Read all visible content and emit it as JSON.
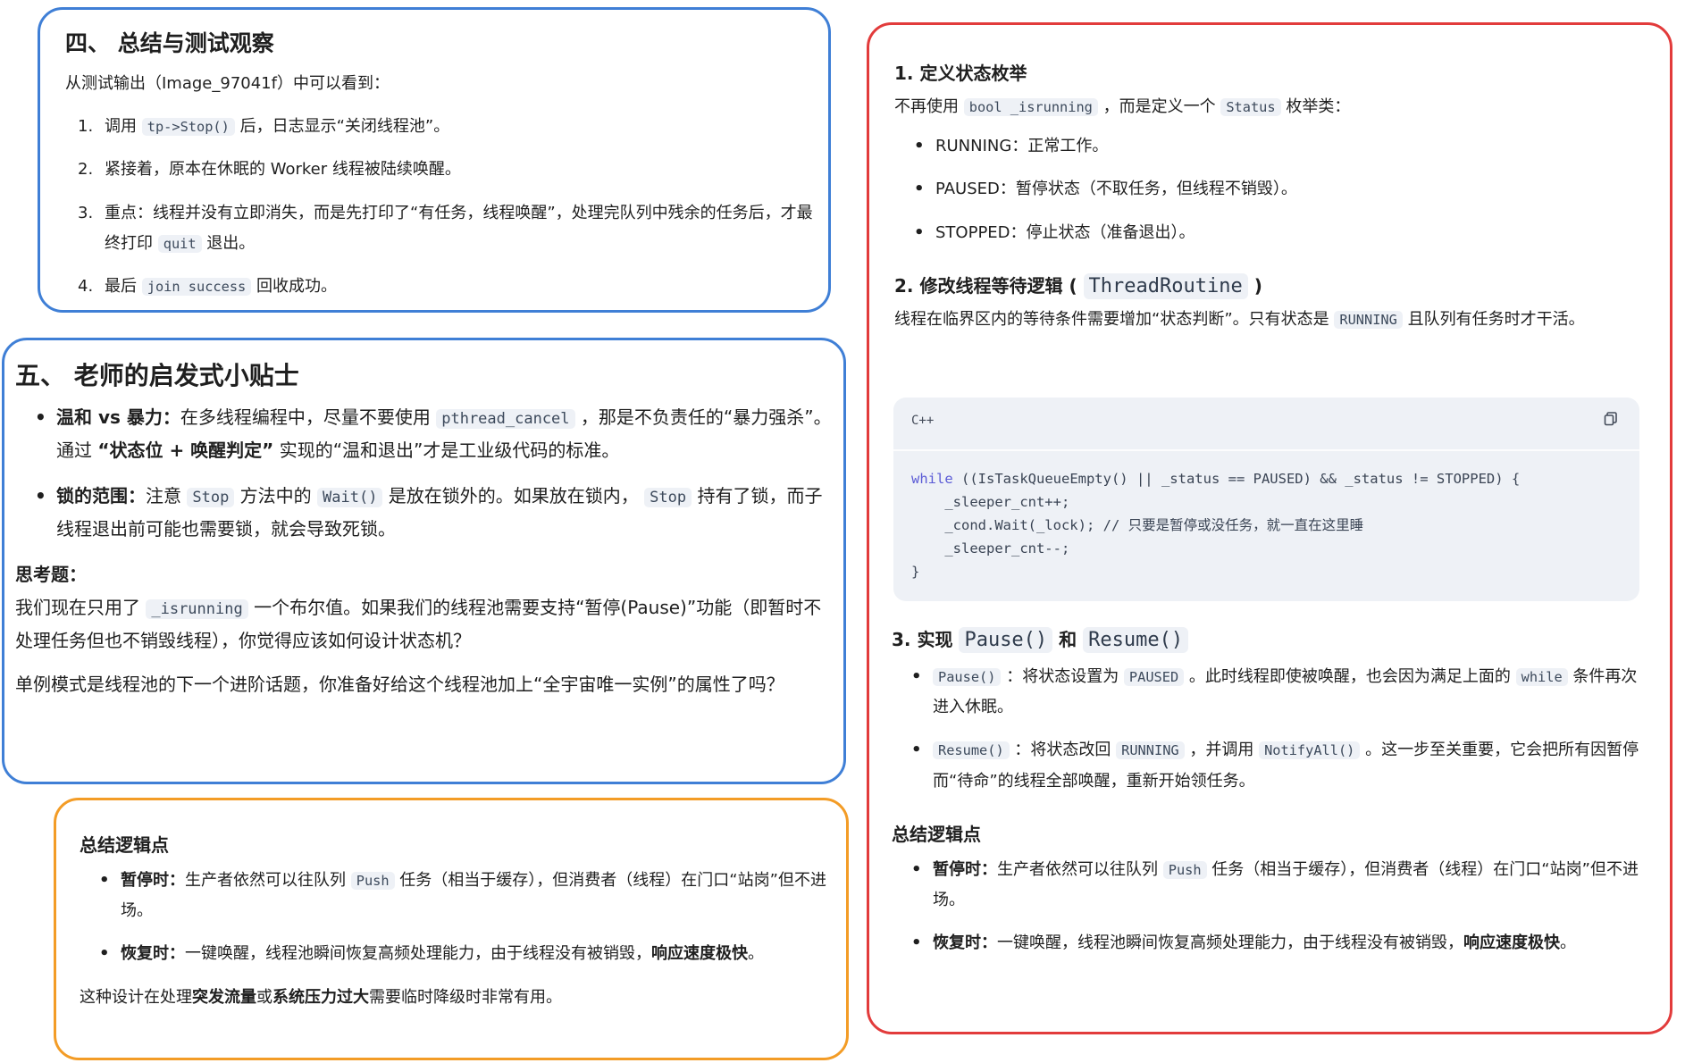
{
  "s4": {
    "title": "四、 总结与测试观察",
    "intro": "从测试输出（Image_97041f）中可以看到：",
    "items": [
      {
        "n": "1.",
        "a": "调用 ",
        "code": "tp->Stop()",
        "b": " 后，日志显示“关闭线程池”。"
      },
      {
        "n": "2.",
        "text": "紧接着，原本在休眠的 Worker 线程被陆续唤醒。"
      },
      {
        "n": "3.",
        "a": "重点：线程并没有立即消失，而是先打印了“有任务，线程唤醒”，处理完队列中残余的任务后，才最终打印 ",
        "code": "quit",
        "b": " 退出。"
      },
      {
        "n": "4.",
        "a": "最后 ",
        "code": "join success",
        "b": " 回收成功。"
      }
    ]
  },
  "s5": {
    "title": "五、 老师的启发式小贴士",
    "b1": {
      "bold": "温和 vs 暴力：",
      "a": "在多线程编程中，尽量不要使用 ",
      "code": "pthread_cancel",
      "b": " ，那是不负责任的“暴力强杀”。通过 ",
      "bold2": "“状态位 + 唤醒判定”",
      "c": " 实现的“温和退出”才是工业级代码的标准。"
    },
    "b2": {
      "bold": "锁的范围：",
      "a": "注意 ",
      "code1": "Stop",
      "b": " 方法中的 ",
      "code2": "Wait()",
      "c": " 是放在锁外的。如果放在锁内， ",
      "code3": "Stop",
      "d": " 持有了锁，而子线程退出前可能也需要锁，就会导致死锁。"
    },
    "think_title": "思考题：",
    "think": {
      "a": "我们现在只用了 ",
      "code": "_isrunning",
      "b": " 一个布尔值。如果我们的线程池需要支持“暂停(Pause)”功能（即暂时不处理任务但也不销毁线程），你觉得应该如何设计状态机？"
    },
    "final": "单例模式是线程池的下一个进阶话题，你准备好给这个线程池加上“全宇宙唯一实例”的属性了吗？"
  },
  "summary_orange": {
    "title": "总结逻辑点",
    "b1": {
      "bold": "暂停时：",
      "a": "生产者依然可以往队列 ",
      "code": "Push",
      "b": " 任务（相当于缓存），但消费者（线程）在门口“站岗”但不进场。"
    },
    "b2": {
      "bold": "恢复时：",
      "a": "一键唤醒，线程池瞬间恢复高频处理能力，由于线程没有被销毁，",
      "bold2": "响应速度极快",
      "b": "。"
    },
    "footer": {
      "a": "这种设计在处理",
      "bold": "突发流量",
      "b": "或",
      "bold2": "系统压力过大",
      "c": "需要临时降级时非常有用。"
    }
  },
  "right": {
    "h1": "1. 定义状态枚举",
    "p1": {
      "a": "不再使用 ",
      "code1": "bool _isrunning",
      "b": " ，而是定义一个 ",
      "code2": "Status",
      "c": " 枚举类："
    },
    "enum": [
      {
        "k": "RUNNING",
        "v": "：正常工作。"
      },
      {
        "k": "PAUSED",
        "v": "：暂停状态（不取任务，但线程不销毁）。"
      },
      {
        "k": "STOPPED",
        "v": "：停止状态（准备退出）。"
      }
    ],
    "h2": {
      "a": "2. 修改线程等待逻辑 ( ",
      "code": "ThreadRoutine",
      "b": " )"
    },
    "p2": {
      "a": "线程在临界区内的等待条件需要增加“状态判断”。只有状态是 ",
      "code": "RUNNING",
      "b": " 且队列有任务时才干活。"
    },
    "code_lang": "C++",
    "code_lines": [
      "while ((IsTaskQueueEmpty() || _status == PAUSED) && _status != STOPPED) {",
      "    _sleeper_cnt++;",
      "    _cond.Wait(_lock); // 只要是暂停或没任务，就一直在这里睡",
      "    _sleeper_cnt--;",
      "}"
    ],
    "h3": {
      "a": "3. 实现 ",
      "code1": "Pause()",
      "b": " 和 ",
      "code2": "Resume()"
    },
    "b_pause": {
      "code": "Pause()",
      "a": " ：将状态设置为 ",
      "code2": "PAUSED",
      "b": " 。此时线程即使被唤醒，也会因为满足上面的 ",
      "code3": "while",
      "c": " 条件再次进入休眠。"
    },
    "b_resume": {
      "code": "Resume()",
      "a": " ：将状态改回 ",
      "code2": "RUNNING",
      "b": " ，并调用 ",
      "code3": "NotifyAll()",
      "c": " 。这一步至关重要，它会把所有因暂停而“待命”的线程全部唤醒，重新开始领任务。"
    },
    "sum_title": "总结逻辑点",
    "sum_b1": {
      "bold": "暂停时：",
      "a": "生产者依然可以往队列 ",
      "code": "Push",
      "b": " 任务（相当于缓存），但消费者（线程）在门口“站岗”但不进场。"
    },
    "sum_b2": {
      "bold": "恢复时：",
      "a": "一键唤醒，线程池瞬间恢复高频处理能力，由于线程没有被销毁，",
      "bold2": "响应速度极快",
      "b": "。"
    }
  }
}
